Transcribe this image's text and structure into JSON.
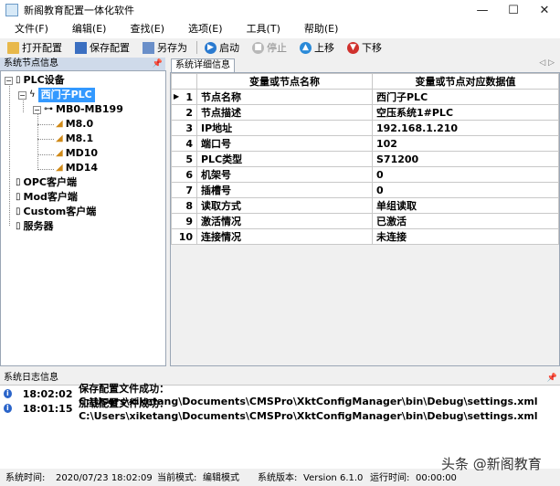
{
  "window": {
    "title": "新阁教育配置一体化软件",
    "controls": [
      "—",
      "☐",
      "✕"
    ]
  },
  "menu": [
    "文件(F)",
    "编辑(E)",
    "查找(E)",
    "选项(E)",
    "工具(T)",
    "帮助(E)"
  ],
  "toolbar": {
    "open": "打开配置",
    "save": "保存配置",
    "save_as": "另存为",
    "start": "启动",
    "stop": "停止",
    "up": "上移",
    "down": "下移"
  },
  "left_panel": {
    "title": "系统节点信息"
  },
  "tree": {
    "root": "PLC设备",
    "device": "西门子PLC",
    "group": "MB0-MB199",
    "vars": [
      "M8.0",
      "M8.1",
      "MD10",
      "MD14"
    ],
    "others": [
      "OPC客户端",
      "Mod客户端",
      "Custom客户端",
      "服务器"
    ]
  },
  "detail": {
    "tab": "系统详细信息",
    "headers": [
      "变量或节点名称",
      "变量或节点对应数据值"
    ],
    "rows": [
      {
        "n": "1",
        "name": "节点名称",
        "value": "西门子PLC"
      },
      {
        "n": "2",
        "name": "节点描述",
        "value": "空压系统1#PLC"
      },
      {
        "n": "3",
        "name": "IP地址",
        "value": "192.168.1.210"
      },
      {
        "n": "4",
        "name": "端口号",
        "value": "102"
      },
      {
        "n": "5",
        "name": "PLC类型",
        "value": "S71200"
      },
      {
        "n": "6",
        "name": "机架号",
        "value": "0"
      },
      {
        "n": "7",
        "name": "插槽号",
        "value": "0"
      },
      {
        "n": "8",
        "name": "读取方式",
        "value": "单组读取"
      },
      {
        "n": "9",
        "name": "激活情况",
        "value": "已激活"
      },
      {
        "n": "10",
        "name": "连接情况",
        "value": "未连接"
      }
    ]
  },
  "log": {
    "title": "系统日志信息",
    "entries": [
      {
        "time": "18:02:02",
        "msg": "保存配置文件成功：C:\\Users\\xiketang\\Documents\\CMSPro\\XktConfigManager\\bin\\Debug\\settings.xml"
      },
      {
        "time": "18:01:15",
        "msg": "加载配置文件成功：C:\\Users\\xiketang\\Documents\\CMSPro\\XktConfigManager\\bin\\Debug\\settings.xml"
      }
    ]
  },
  "status": {
    "time_label": "系统时间:",
    "time": "2020/07/23 18:02:09",
    "mode_label": "当前模式:",
    "mode": "编辑模式",
    "version_label": "系统版本:",
    "version": "Version  6.1.0",
    "runtime_label": "运行时间:",
    "runtime": "00:00:00"
  },
  "watermark": "头条 @新阁教育"
}
